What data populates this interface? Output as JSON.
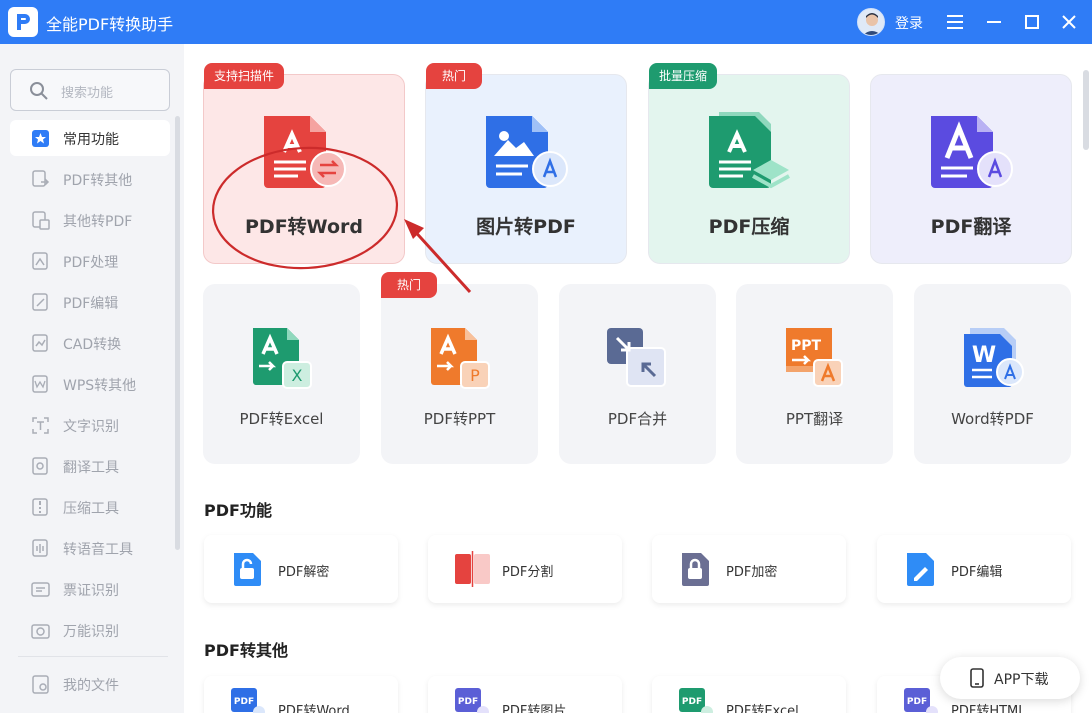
{
  "app": {
    "title": "全能PDF转换助手",
    "login_label": "登录"
  },
  "colors": {
    "brand": "#2f7cf6",
    "red": "#e5433f",
    "green": "#1e9b6f",
    "purple": "#5b4be0",
    "orange": "#ef7a2c"
  },
  "search": {
    "placeholder": "搜索功能"
  },
  "sidebar": {
    "items": [
      {
        "label": "常用功能",
        "icon": "star-grid-icon"
      },
      {
        "label": "PDF转其他",
        "icon": "pdf-convert-icon"
      },
      {
        "label": "其他转PDF",
        "icon": "to-pdf-icon"
      },
      {
        "label": "PDF处理",
        "icon": "pdf-process-icon"
      },
      {
        "label": "PDF编辑",
        "icon": "pdf-edit-icon"
      },
      {
        "label": "CAD转换",
        "icon": "cad-icon"
      },
      {
        "label": "WPS转其他",
        "icon": "wps-icon"
      },
      {
        "label": "文字识别",
        "icon": "ocr-icon"
      },
      {
        "label": "翻译工具",
        "icon": "translate-icon"
      },
      {
        "label": "压缩工具",
        "icon": "compress-icon"
      },
      {
        "label": "转语音工具",
        "icon": "voice-icon"
      },
      {
        "label": "票证识别",
        "icon": "ticket-icon"
      },
      {
        "label": "万能识别",
        "icon": "camera-icon"
      }
    ],
    "bottom": {
      "label": "我的文件",
      "icon": "folder-icon"
    }
  },
  "featured": [
    {
      "name": "PDF转Word",
      "tag": "支持扫描件"
    },
    {
      "name": "图片转PDF",
      "tag": "热门"
    },
    {
      "name": "PDF压缩",
      "tag": "批量压缩"
    },
    {
      "name": "PDF翻译",
      "tag": ""
    }
  ],
  "tools": [
    {
      "name": "PDF转Excel",
      "tag": ""
    },
    {
      "name": "PDF转PPT",
      "tag": "热门"
    },
    {
      "name": "PDF合并",
      "tag": ""
    },
    {
      "name": "PPT翻译",
      "tag": ""
    },
    {
      "name": "Word转PDF",
      "tag": ""
    }
  ],
  "sections": [
    {
      "title": "PDF功能",
      "items": [
        "PDF解密",
        "PDF分割",
        "PDF加密",
        "PDF编辑"
      ]
    },
    {
      "title": "PDF转其他",
      "items": [
        "PDF转Word",
        "PDF转图片",
        "PDF转Excel",
        "PDF转HTML"
      ]
    }
  ],
  "icon_text": {
    "pdf": "PDF",
    "ppt": "PPT",
    "p": "P",
    "w": "W",
    "x": "X"
  },
  "app_download": {
    "label": "APP下载"
  }
}
